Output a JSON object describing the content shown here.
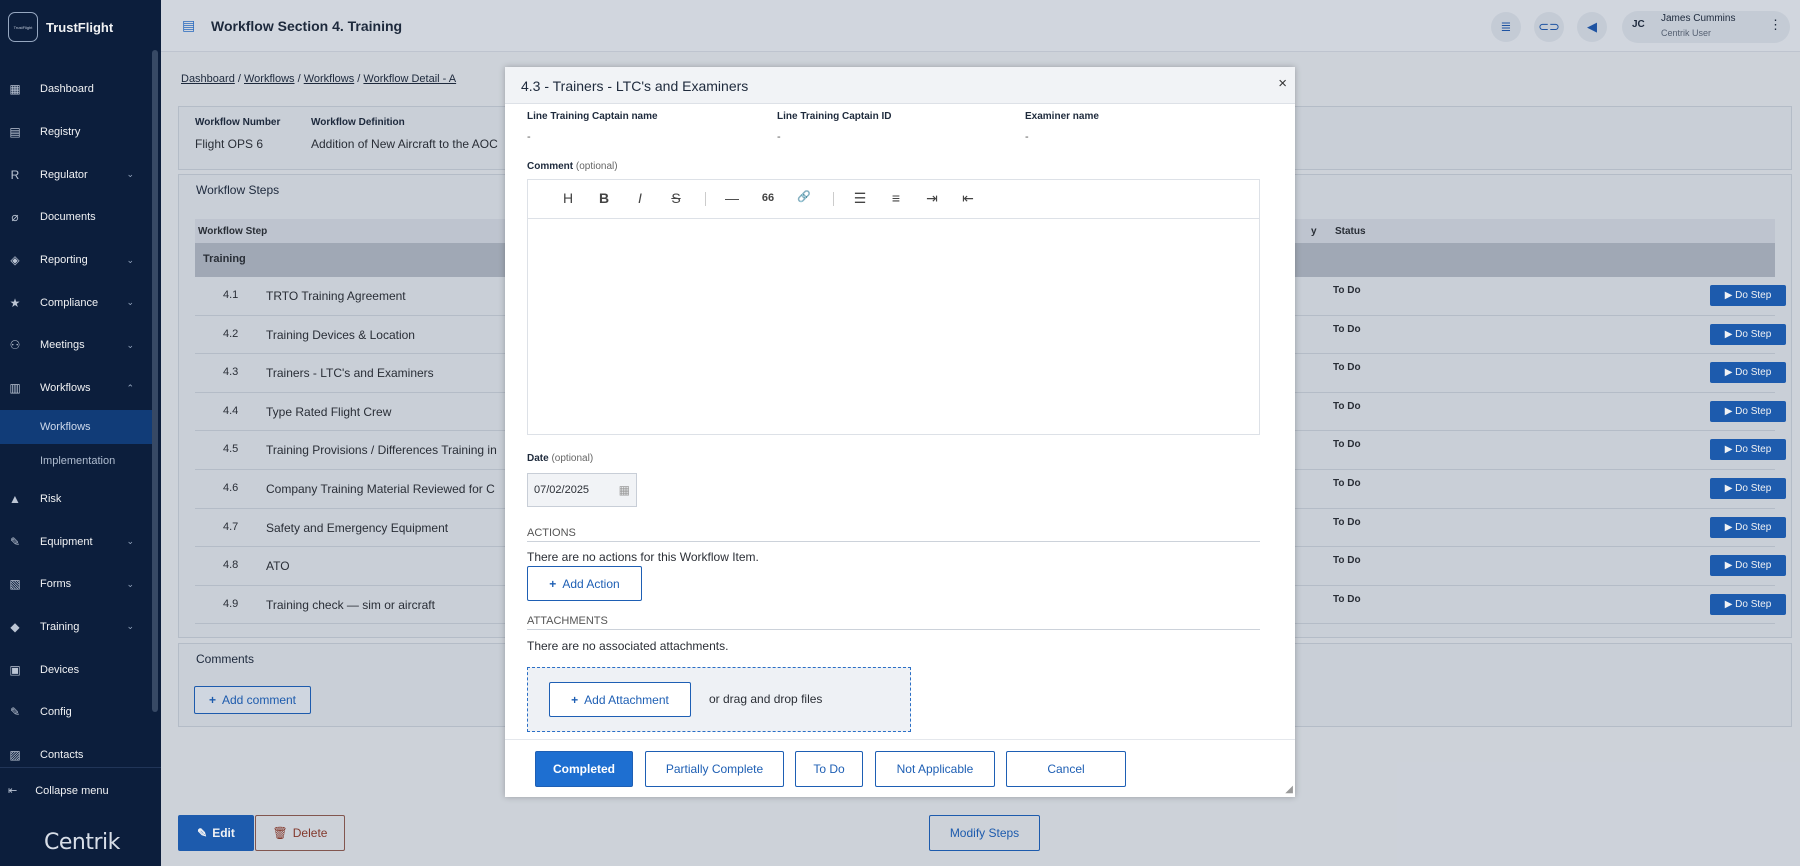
{
  "sidebar": {
    "logo_small": "TrustFlight",
    "logo_text": "TrustFlight",
    "items": [
      {
        "label": "Dashboard",
        "icon": "dashboard-icon",
        "chevron": ""
      },
      {
        "label": "Registry",
        "icon": "registry-icon",
        "chevron": ""
      },
      {
        "label": "Regulator",
        "icon": "R",
        "chevron": "⌄"
      },
      {
        "label": "Documents",
        "icon": "paperclip-icon",
        "chevron": ""
      },
      {
        "label": "Reporting",
        "icon": "reporting-icon",
        "chevron": "⌄"
      },
      {
        "label": "Compliance",
        "icon": "star-icon",
        "chevron": "⌄"
      },
      {
        "label": "Meetings",
        "icon": "meetings-icon",
        "chevron": "⌄"
      },
      {
        "label": "Workflows",
        "icon": "workflows-icon",
        "chevron": "⌃"
      }
    ],
    "sub_items": [
      {
        "label": "Workflows",
        "active": true
      },
      {
        "label": "Implementation",
        "active": false
      }
    ],
    "items2": [
      {
        "label": "Risk",
        "icon": "warning-icon",
        "chevron": ""
      },
      {
        "label": "Equipment",
        "icon": "wrench-icon",
        "chevron": "⌄"
      },
      {
        "label": "Forms",
        "icon": "forms-icon",
        "chevron": "⌄"
      },
      {
        "label": "Training",
        "icon": "graduation-icon",
        "chevron": "⌄"
      },
      {
        "label": "Devices",
        "icon": "devices-icon",
        "chevron": ""
      },
      {
        "label": "Config",
        "icon": "wrench-icon",
        "chevron": ""
      },
      {
        "label": "Contacts",
        "icon": "contacts-icon",
        "chevron": ""
      }
    ],
    "collapse_label": "Collapse menu",
    "footer_logo": "Centrik"
  },
  "header": {
    "title": "Workflow Section 4. Training",
    "user_initials": "JC",
    "user_name": "James Cummins",
    "user_role": "Centrik User"
  },
  "breadcrumb": [
    "Dashboard",
    "Workflows",
    "Workflows",
    "Workflow Detail - A"
  ],
  "workflow_info": {
    "number_label": "Workflow Number",
    "number_value": "Flight OPS 6",
    "definition_label": "Workflow Definition",
    "definition_value": "Addition of New Aircraft to the AOC"
  },
  "steps_panel": {
    "title": "Workflow Steps",
    "col_step": "Workflow Step",
    "col_assigned": "y",
    "col_status": "Status",
    "group": "Training",
    "rows": [
      {
        "num": "4.1",
        "name": "TRTO Training Agreement",
        "status": "To Do",
        "action": "▶ Do Step"
      },
      {
        "num": "4.2",
        "name": "Training Devices & Location",
        "status": "To Do",
        "action": "▶ Do Step"
      },
      {
        "num": "4.3",
        "name": "Trainers - LTC's and Examiners",
        "status": "To Do",
        "action": "▶ Do Step"
      },
      {
        "num": "4.4",
        "name": "Type Rated Flight Crew",
        "status": "To Do",
        "action": "▶ Do Step"
      },
      {
        "num": "4.5",
        "name": "Training Provisions / Differences Training in",
        "status": "To Do",
        "action": "▶ Do Step"
      },
      {
        "num": "4.6",
        "name": "Company Training Material Reviewed for C",
        "status": "To Do",
        "action": "▶ Do Step"
      },
      {
        "num": "4.7",
        "name": "Safety and Emergency Equipment",
        "status": "To Do",
        "action": "▶ Do Step"
      },
      {
        "num": "4.8",
        "name": "ATO",
        "status": "To Do",
        "action": "▶ Do Step"
      },
      {
        "num": "4.9",
        "name": "Training check — sim or aircraft",
        "status": "To Do",
        "action": "▶ Do Step"
      }
    ]
  },
  "comments_panel": {
    "title": "Comments",
    "add_label": "Add comment"
  },
  "page_actions": {
    "edit": "Edit",
    "delete": "Delete",
    "modify": "Modify Steps"
  },
  "modal": {
    "title": "4.3 - Trainers - LTC's and Examiners",
    "close": "×",
    "fields": [
      {
        "label": "Line Training Captain name",
        "value": "-"
      },
      {
        "label": "Line Training Captain ID",
        "value": "-"
      },
      {
        "label": "Examiner name",
        "value": "-"
      }
    ],
    "comment_label": "Comment",
    "optional": "(optional)",
    "toolbar": [
      "H",
      "B",
      "I",
      "S",
      "—",
      "66",
      "🔗",
      "☰",
      "≡",
      "⇥",
      "⇤"
    ],
    "date_label": "Date",
    "date_value": "07/02/2025",
    "actions_heading": "ACTIONS",
    "actions_empty": "There are no actions for this Workflow Item.",
    "add_action": "Add Action",
    "attachments_heading": "ATTACHMENTS",
    "attachments_empty": "There are no associated attachments.",
    "add_attachment": "Add Attachment",
    "drag_text": "or drag and drop files",
    "buttons": {
      "completed": "Completed",
      "partial": "Partially Complete",
      "todo": "To Do",
      "na": "Not Applicable",
      "cancel": "Cancel"
    }
  }
}
